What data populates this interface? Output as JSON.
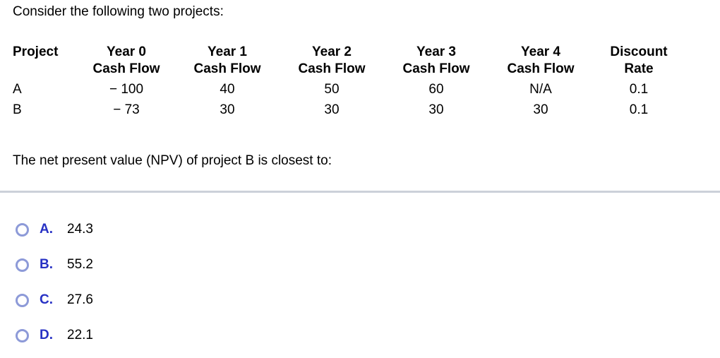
{
  "intro": "Consider the following two projects:",
  "table": {
    "headers": [
      {
        "line1": "Project",
        "line2": ""
      },
      {
        "line1": "Year 0",
        "line2": "Cash Flow"
      },
      {
        "line1": "Year 1",
        "line2": "Cash Flow"
      },
      {
        "line1": "Year 2",
        "line2": "Cash Flow"
      },
      {
        "line1": "Year 3",
        "line2": "Cash Flow"
      },
      {
        "line1": "Year 4",
        "line2": "Cash Flow"
      },
      {
        "line1": "Discount",
        "line2": "Rate"
      }
    ],
    "rows": [
      {
        "project": "A",
        "year0": "− 100",
        "year1": "40",
        "year2": "50",
        "year3": "60",
        "year4": "N/A",
        "discount_rate": "0.1"
      },
      {
        "project": "B",
        "year0": "− 73",
        "year1": "30",
        "year2": "30",
        "year3": "30",
        "year4": "30",
        "discount_rate": "0.1"
      }
    ]
  },
  "question": "The net present value (NPV) of project B is closest to:",
  "options": [
    {
      "letter": "A.",
      "value": "24.3"
    },
    {
      "letter": "B.",
      "value": "55.2"
    },
    {
      "letter": "C.",
      "value": "27.6"
    },
    {
      "letter": "D.",
      "value": "22.1"
    }
  ],
  "colors": {
    "option_letter": "#2731c4",
    "radio_ring": "#8d9ad8",
    "divider": "#ccd1d9",
    "text": "#000000",
    "background": "#ffffff"
  }
}
